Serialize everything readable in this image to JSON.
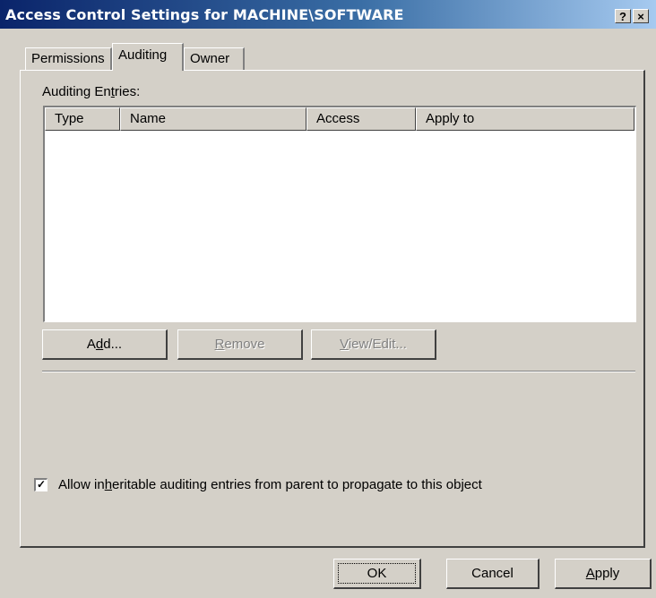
{
  "window": {
    "title": "Access Control Settings for MACHINE\\SOFTWARE",
    "help_glyph": "?",
    "close_glyph": "×"
  },
  "tabs": [
    {
      "label": "Permissions",
      "selected": false
    },
    {
      "label": "Auditing",
      "selected": true
    },
    {
      "label": "Owner",
      "selected": false
    }
  ],
  "auditing": {
    "entries_label_pre": "Auditing En",
    "entries_label_mnemonic": "t",
    "entries_label_post": "ries:",
    "columns": [
      "Type",
      "Name",
      "Access",
      "Apply to"
    ],
    "rows": [],
    "buttons": {
      "add_pre": "A",
      "add_mnemonic": "d",
      "add_post": "d...",
      "remove_mnemonic": "R",
      "remove_post": "emove",
      "view_mnemonic": "V",
      "view_post": "iew/Edit..."
    },
    "inherit": {
      "checked": true,
      "check_glyph": "✓",
      "label_pre": "Allow in",
      "label_mnemonic": "h",
      "label_post": "eritable auditing entries from parent to propagate to this object"
    }
  },
  "footer": {
    "ok_label": "OK",
    "cancel_label": "Cancel",
    "apply_mnemonic": "A",
    "apply_post": "pply"
  },
  "colors": {
    "title_start": "#0a246a",
    "title_end": "#a6caf0",
    "face": "#d4d0c8"
  }
}
